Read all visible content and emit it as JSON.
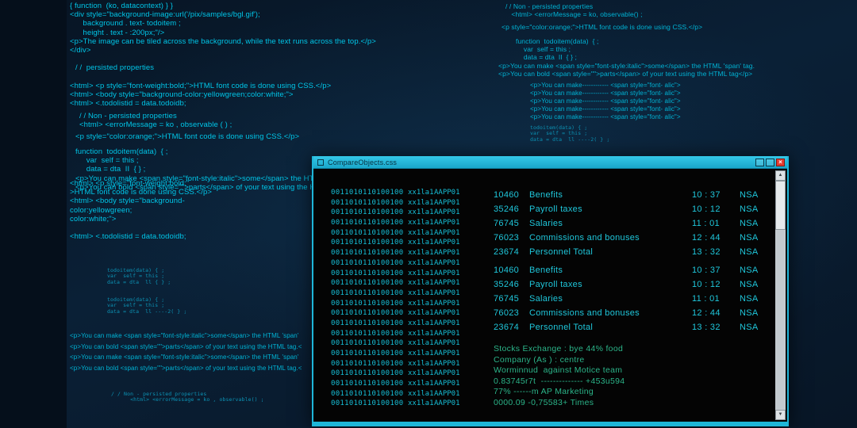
{
  "colors": {
    "background_navy": "#0a2036",
    "code_cyan": "#00c6e8",
    "titlebar_cyan": "#22b7d9",
    "terminal_text": "#1fc6da",
    "footer_green": "#2bb489",
    "close_red": "#e53a2e"
  },
  "background": {
    "blocks": {
      "a": {
        "text": "{ function  (ko, datacontext) } }\n<div style=\"background-image:url('/pix/samples/bgl.gif');\n      background . text- todoitem ;\n      height . text - :200px;\"/>\n<p>The image can be tiled across the background, while the text runs across the top.</p>\n</div>"
      },
      "b": {
        "text": "/ /  persisted properties"
      },
      "c": {
        "text": "<html> <p style=\"font-weight:bold;\">HTML font code is done using CSS.</p>\n<html> <body style=\"background-color:yellowgreen;color:white;\">\n<html> <.todolistid = data.todoidb;"
      },
      "d": {
        "text": "/ / Non - persisted properties\n<html> <errorMessage = ko , observable ( ) ;"
      },
      "e": {
        "text": "<p style=\"color:orange;\">HTML font code is done using CSS.</p>"
      },
      "f": {
        "text": "function  todoitem(data)  { ;\n     var  self = this ;\n     data = dta  II  { } ;\n<p>You can make <span style=\"font-style:italic\">some</span> the HTML 'span' tag.\n<p>You can bold <span style=\"\">parts</span> of your text using the HTML tag.</p>"
      },
      "g": {
        "text": "<html> <p style=\"font-weight:bold;\"\n>HTML font code is done using CSS.</p>\n<html> <body style=\"background-\ncolor:yellowgreen;\ncolor:white;\">\n\n<html> <.todolistid = data.todoidb;"
      },
      "h": {
        "text": "todoitem(data) { ;\nvar  self = this ;\ndata = dta  ll { } ;\n\n\ntodoitem(data) { ;\nvar  self = this ;\ndata = dta  ll ----2( } ;"
      },
      "i": {
        "text": "<p>You can make <span style=\"font-style:italic\">some</span> the HTML 'span'\n<p>You can bold <span style=\"\">parts</span> of your text using the HTML tag.<\n<p>You can make <span style=\"font-style:italic\">some</span> the HTML 'span'\n<p>You can bold <span style=\"\">parts</span> of your text using the HTML tag.<"
      },
      "j": {
        "text": "/ / Non - persisted properties\n      <html> <errorMessage = ko , observable() ;"
      },
      "k": {
        "text": "/ / Non - persisted properties\n   <html> <errorMessage = ko, observable() ;"
      },
      "l": {
        "text": "<p style=\"color:orange;\">HTML font code is done using CSS.</p>"
      },
      "m": {
        "text": "function  todoitem(data)  { ;\n    var  self = this ;\n    data = dta  II  { } ;"
      },
      "n": {
        "text": "<p>You can make <span style=\"font-style:italic\">some</span> the HTML 'span' tag.\n<p>You can bold <span style=\"\">parts</span> of your text using the HTML tag</p>"
      },
      "o": {
        "text": "<p>You can make------------ <span style=\"font- alic\">\n<p>You can make------------ <span style=\"font- alic\">\n<p>You can make------------ <span style=\"font- alic\">\n<p>You can make------------ <span style=\"font- alic\">\n<p>You can make------------ <span style=\"font- alic\">"
      },
      "p": {
        "text": "todoitem(data) { ;\nvar  self = this ;\ndata = dta  ll ----2( } ;"
      }
    }
  },
  "window": {
    "title": "CompareObjects.css",
    "controls": {
      "close_label": "×"
    },
    "terminal": {
      "binary_row": {
        "bits": "0011010110100100",
        "code1": "xx1la1",
        "code2": "AAPP01"
      },
      "binary_row_count": 22,
      "financial_rows": [
        {
          "amount": "10460",
          "label": "Benefits",
          "time": "10 : 37",
          "agency": "NSA"
        },
        {
          "amount": "35246",
          "label": "Payroll taxes",
          "time": "10 : 12",
          "agency": "NSA"
        },
        {
          "amount": "76745",
          "label": "Salaries",
          "time": "11 : 01",
          "agency": "NSA"
        },
        {
          "amount": "76023",
          "label": "Commissions and bonuses",
          "time": "12 : 44",
          "agency": "NSA"
        },
        {
          "amount": "23674",
          "label": "Personnel Total",
          "time": "13 : 32",
          "agency": "NSA"
        },
        {
          "amount": "10460",
          "label": "Benefits",
          "time": "10 : 37",
          "agency": "NSA"
        },
        {
          "amount": "35246",
          "label": "Payroll taxes",
          "time": "10 : 12",
          "agency": "NSA"
        },
        {
          "amount": "76745",
          "label": "Salaries",
          "time": "11 : 01",
          "agency": "NSA"
        },
        {
          "amount": "76023",
          "label": "Commissions and bonuses",
          "time": "12 : 44",
          "agency": "NSA"
        },
        {
          "amount": "23674",
          "label": "Personnel Total",
          "time": "13 : 32",
          "agency": "NSA"
        }
      ],
      "footer": "Stocks Exchange : bye 44% food\nCompany (As ) : centre\nWorminnud  against Motice team\n0.83745r7t  -------------- +453u594\n77% ------m AP Marketing\n0000.09 -0,75583+ Times"
    }
  }
}
